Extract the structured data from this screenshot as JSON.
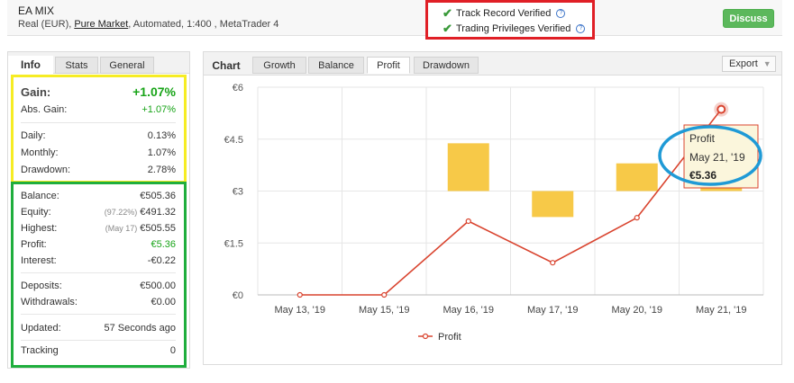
{
  "header": {
    "account_name": "EA MIX",
    "subtitle_prefix": "Real (EUR), ",
    "market_link": "Pure Market",
    "subtitle_suffix": ", Automated, 1:400 , MetaTrader 4",
    "verified": [
      "Track Record Verified",
      "Trading Privileges Verified"
    ],
    "discuss_label": "Discuss"
  },
  "left_tabs": {
    "label": "Info",
    "stats": "Stats",
    "general": "General"
  },
  "gain": {
    "label": "Gain:",
    "value": "+1.07%"
  },
  "abs_gain": {
    "label": "Abs. Gain:",
    "value": "+1.07%"
  },
  "daily": {
    "label": "Daily:",
    "value": "0.13%"
  },
  "monthly": {
    "label": "Monthly:",
    "value": "1.07%"
  },
  "drawdown": {
    "label": "Drawdown:",
    "value": "2.78%"
  },
  "balance": {
    "label": "Balance:",
    "value": "€505.36"
  },
  "equity": {
    "label": "Equity:",
    "note": "(97.22%)",
    "value": "€491.32"
  },
  "highest": {
    "label": "Highest:",
    "note": "(May 17)",
    "value": "€505.55"
  },
  "profit": {
    "label": "Profit:",
    "value": "€5.36"
  },
  "interest": {
    "label": "Interest:",
    "value": "-€0.22"
  },
  "deposits": {
    "label": "Deposits:",
    "value": "€500.00"
  },
  "withdrawals": {
    "label": "Withdrawals:",
    "value": "€0.00"
  },
  "updated": {
    "label": "Updated:",
    "value": "57 Seconds ago"
  },
  "tracking": {
    "label": "Tracking",
    "value": "0"
  },
  "chart_tabs": {
    "label": "Chart",
    "growth": "Growth",
    "balance": "Balance",
    "profit": "Profit",
    "drawdown": "Drawdown",
    "export": "Export"
  },
  "tooltip": {
    "series": "Profit",
    "date": "May 21, '19",
    "value": "€5.36"
  },
  "colors": {
    "line": "#d9442f",
    "bar": "#f7c948",
    "verify_box": "#e01f26",
    "info_box": "#f6ec24",
    "stats_box": "#1fae3d",
    "tooltip_circle": "#1f9ad6",
    "gain": "#18a418"
  },
  "chart_data": {
    "type": "line",
    "categories": [
      "May 13, '19",
      "May 15, '19",
      "May 16, '19",
      "May 17, '19",
      "May 20, '19",
      "May 21, '19"
    ],
    "ylim": [
      0,
      6
    ],
    "y_ticks": [
      "€0",
      "€1.5",
      "€3",
      "€4.5",
      "€6"
    ],
    "grid": true,
    "legend": "bottom-center",
    "series": [
      {
        "name": "Profit",
        "type": "line",
        "values": [
          0,
          0,
          2.13,
          0.93,
          2.23,
          5.36
        ]
      }
    ],
    "bars": [
      {
        "category_index": 2,
        "from": 3,
        "to": 4.38
      },
      {
        "category_index": 3,
        "from": 2.25,
        "to": 3
      },
      {
        "category_index": 4,
        "from": 3,
        "to": 3.8
      },
      {
        "category_index": 5,
        "from": 3,
        "to": 4.5
      }
    ]
  }
}
